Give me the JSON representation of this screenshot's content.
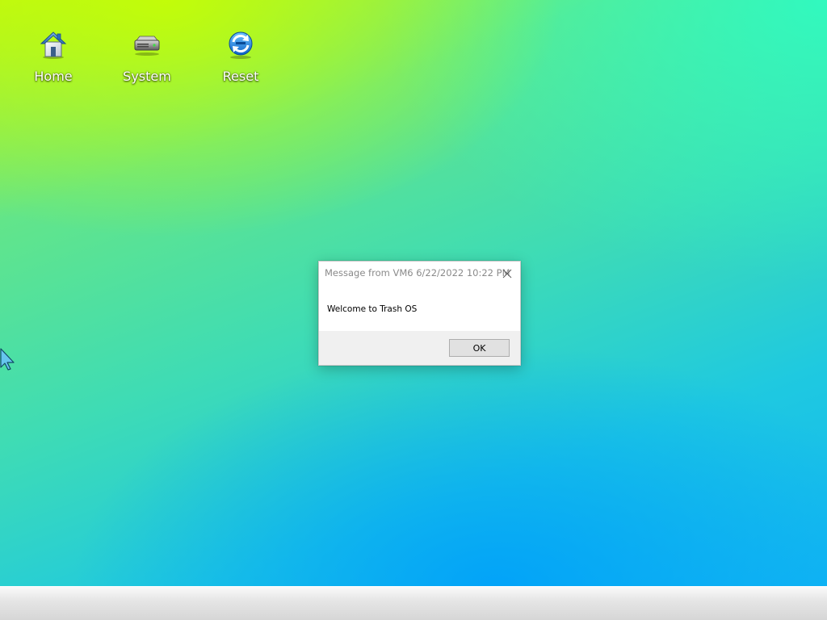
{
  "desktop": {
    "icons": [
      {
        "label": "Home",
        "icon": "house-icon"
      },
      {
        "label": "System",
        "icon": "hard-drive-icon"
      },
      {
        "label": "Reset",
        "icon": "refresh-icon"
      }
    ]
  },
  "dialog": {
    "title": "Message from VM6 6/22/2022 10:22 PM",
    "message": "Welcome to Trash OS",
    "ok_label": "OK",
    "close_icon": "close-icon"
  },
  "colors": {
    "dialog_footer": "#f0f0f0",
    "button_face": "#e1e1e1",
    "title_text": "#8a8a8a"
  }
}
